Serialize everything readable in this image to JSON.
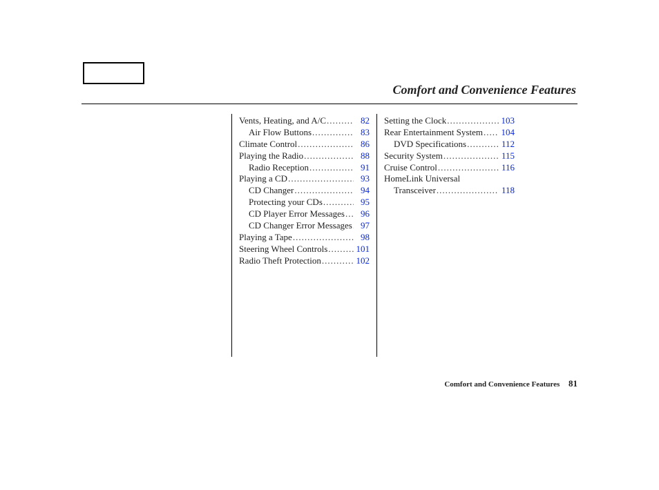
{
  "title": "Comfort and Convenience Features",
  "footer": {
    "label": "Comfort and Convenience Features",
    "page": "81"
  },
  "col1": [
    {
      "label": "Vents, Heating, and A/C",
      "page": "82",
      "indent": 0
    },
    {
      "label": "Air Flow Buttons",
      "page": "83",
      "indent": 1
    },
    {
      "label": "Climate Control",
      "page": "86",
      "indent": 0
    },
    {
      "label": "Playing the Radio",
      "page": "88",
      "indent": 0
    },
    {
      "label": "Radio Reception",
      "page": "91",
      "indent": 1
    },
    {
      "label": "Playing a CD",
      "page": "93",
      "indent": 0
    },
    {
      "label": "CD Changer",
      "page": "94",
      "indent": 1
    },
    {
      "label": "Protecting your CDs",
      "page": "95",
      "indent": 1
    },
    {
      "label": "CD Player Error Messages",
      "page": "96",
      "indent": 1
    },
    {
      "label": "CD Changer Error Messages",
      "page": "97",
      "indent": 1
    },
    {
      "label": "Playing a Tape",
      "page": "98",
      "indent": 0
    },
    {
      "label": "Steering Wheel Controls",
      "page": "101",
      "indent": 0
    },
    {
      "label": "Radio Theft Protection",
      "page": "102",
      "indent": 0
    }
  ],
  "col2": [
    {
      "label": "Setting the Clock",
      "page": "103",
      "indent": 0
    },
    {
      "label": "Rear Entertainment System",
      "page": "104",
      "indent": 0
    },
    {
      "label": "DVD Specifications",
      "page": "112",
      "indent": 1
    },
    {
      "label": "Security System",
      "page": "115",
      "indent": 0
    },
    {
      "label": "Cruise Control",
      "page": "116",
      "indent": 0
    }
  ],
  "col2_wrap": {
    "line1": "HomeLink Universal",
    "line2": "Transceiver",
    "page": "118"
  }
}
